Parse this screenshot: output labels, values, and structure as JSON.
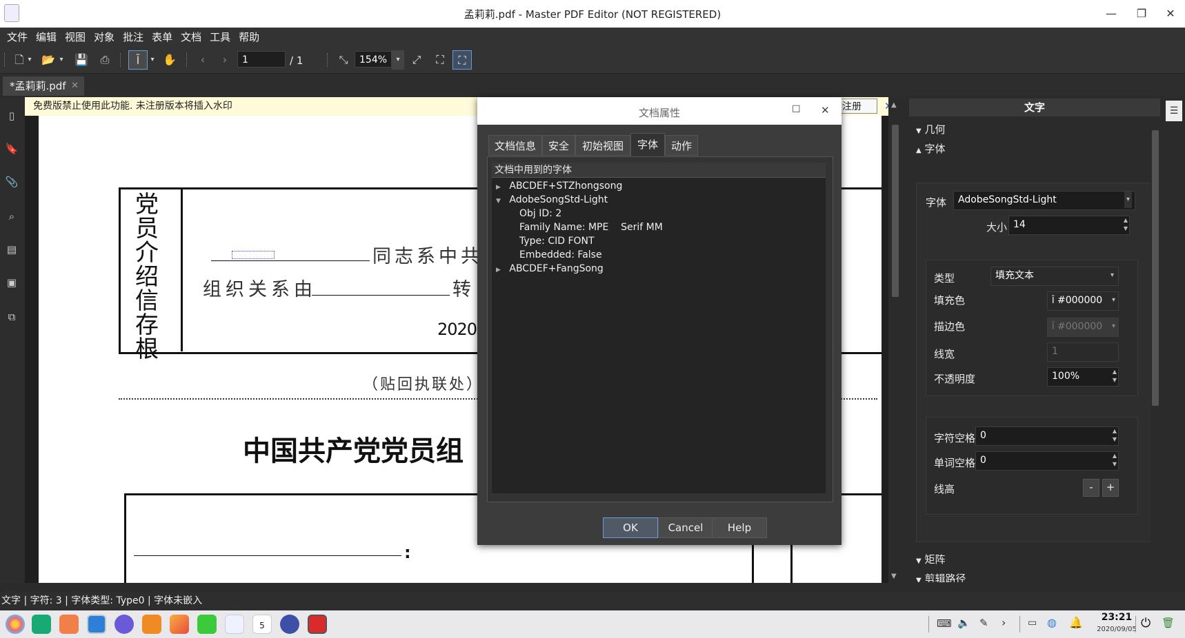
{
  "window": {
    "title": "孟莉莉.pdf - Master PDF Editor (NOT REGISTERED)"
  },
  "menu": [
    "文件",
    "编辑",
    "视图",
    "对象",
    "批注",
    "表单",
    "文档",
    "工具",
    "帮助"
  ],
  "toolbar": {
    "page_current": "1",
    "page_total": "/ 1",
    "zoom": "154%"
  },
  "tab": {
    "label": "*孟莉莉.pdf"
  },
  "notice": {
    "text": "免费版禁止使用此功能. 未注册版本将插入水印",
    "register_fragment": "注册"
  },
  "document": {
    "stub_vertical_title": "党员介绍信存根",
    "line1": "同志系中共",
    "line2_prefix": "组织关系由",
    "line2_suffix": "转",
    "year": "2020",
    "attach_note": "（贴回执联处）",
    "main_title": "中国共产党党员组",
    "colon": ":"
  },
  "dialog": {
    "title": "文档属性",
    "tabs": [
      "文档信息",
      "安全",
      "初始视图",
      "字体",
      "动作"
    ],
    "active_tab": "字体",
    "section_header": "文档中用到的字体",
    "fonts": [
      {
        "name": "ABCDEF+STZhongsong",
        "expanded": false,
        "details": []
      },
      {
        "name": "AdobeSongStd-Light",
        "expanded": true,
        "details": [
          "Obj ID: 2",
          "Family Name: MPE    Serif MM",
          "Type: CID FONT",
          "Embedded: False"
        ]
      },
      {
        "name": "ABCDEF+FangSong",
        "expanded": false,
        "details": []
      }
    ],
    "buttons": {
      "ok": "OK",
      "cancel": "Cancel",
      "help": "Help"
    }
  },
  "properties": {
    "header": "文字",
    "sections": {
      "geometry": "几何",
      "font": "字体",
      "matrix": "矩阵",
      "clip": "剪辑路径"
    },
    "font_label": "字体",
    "font_value": "AdobeSongStd-Light",
    "size_label": "大小",
    "size_value": "14",
    "type_label": "类型",
    "type_value": "填充文本",
    "fill_label": "填充色",
    "fill_value": "#000000",
    "stroke_label": "描边色",
    "stroke_value": "#000000",
    "linewidth_label": "线宽",
    "linewidth_value": "1",
    "opacity_label": "不透明度",
    "opacity_value": "100%",
    "charspace_label": "字符空格",
    "charspace_value": "0",
    "wordspace_label": "单词空格",
    "wordspace_value": "0",
    "lineheight_label": "线高",
    "minus": "-",
    "plus": "+"
  },
  "status": {
    "text": "文字 | 字符: 3 | 字体类型: Type0 | 字体未嵌入"
  },
  "taskbar": {
    "time": "23:21",
    "date": "2020/09/05",
    "calendar_day": "5"
  }
}
